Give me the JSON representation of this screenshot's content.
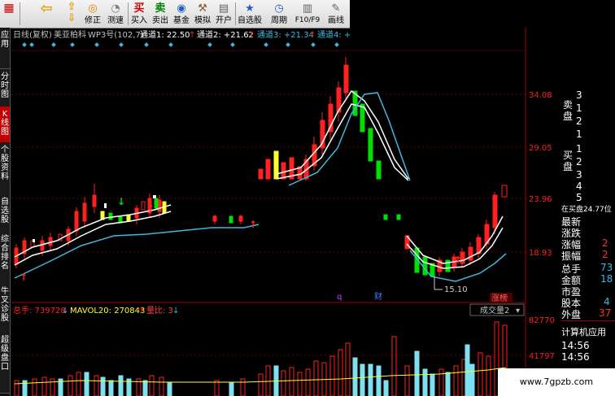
{
  "toolbar": {
    "buttons": [
      {
        "label": "",
        "icon": "back-arrow-icon"
      },
      {
        "label": "",
        "icon": "up-arrow-icon"
      },
      {
        "label": "",
        "icon": "down-arrow-icon"
      },
      {
        "label": "修正",
        "icon": "refresh-icon"
      },
      {
        "label": "测速",
        "icon": "stopwatch-icon"
      },
      {
        "label": "买入",
        "icon": "buy-icon"
      },
      {
        "label": "卖出",
        "icon": "sell-icon"
      },
      {
        "label": "基金",
        "icon": "globe-icon"
      },
      {
        "label": "模拟",
        "icon": "gavel-icon"
      },
      {
        "label": "开户",
        "icon": "form-icon"
      },
      {
        "label": "自选股",
        "icon": "star-icon"
      },
      {
        "label": "周期",
        "icon": "clock-icon"
      },
      {
        "label": "F10/F9",
        "icon": "document-icon"
      },
      {
        "label": "画线",
        "icon": "pencil-icon"
      }
    ],
    "buy_char": "买",
    "sell_char": "卖"
  },
  "left_tabs": [
    "应用",
    "分时图",
    "K线图",
    "个股资料",
    "自选股",
    "综合排名",
    "牛叉诊股",
    "超级盘口"
  ],
  "chart_header": {
    "period": "日线(复权)",
    "stock_name": "美亚柏科",
    "indicator": "WP3号(102,7)",
    "ch1": "通道1: 22.50",
    "ch2": "通道2: +21.62",
    "ch3": "通道3: +21.34",
    "ch4": "通道4: +"
  },
  "price_axis": [
    "34.08",
    "29.05",
    "23.96",
    "18.93"
  ],
  "annotations": {
    "low_price": "15.10",
    "marker_q": "q",
    "marker_cai": "财",
    "badge": "涨榜"
  },
  "volume_header": {
    "total": "总手: 739728",
    "mavol": "MAVOL20: 270843",
    "ratio": "量比: 3",
    "dropdown": "成交量2"
  },
  "volume_axis": [
    "82770",
    "41797"
  ],
  "right_panel": {
    "sell_label": "卖盘",
    "sell_values": [
      "3",
      "1",
      "2",
      "1"
    ],
    "buy_label": "买盘",
    "buy_values": [
      "1",
      "2",
      "3",
      "4",
      "5"
    ],
    "bid_price": "在买盘24.77位",
    "fields": [
      {
        "label": "最新",
        "value": ""
      },
      {
        "label": "涨跌",
        "value": ""
      },
      {
        "label": "涨幅",
        "value": "2"
      },
      {
        "label": "振幅",
        "value": "2"
      },
      {
        "label": "总手",
        "value": "73"
      },
      {
        "label": "金额",
        "value": "18"
      },
      {
        "label": "市盈",
        "value": ""
      },
      {
        "label": "股本",
        "value": "4"
      },
      {
        "label": "外盘",
        "value": "37"
      }
    ],
    "sector": "计算机应用",
    "times": [
      "14:56",
      "14:56"
    ]
  },
  "watermark": "www.7gpzb.com",
  "colors": {
    "up": "#ff2020",
    "down": "#00e000",
    "up_alt": "#ffff30",
    "channel": "#ffffff",
    "outer": "#40b8e0",
    "axis": "#a00000"
  }
}
